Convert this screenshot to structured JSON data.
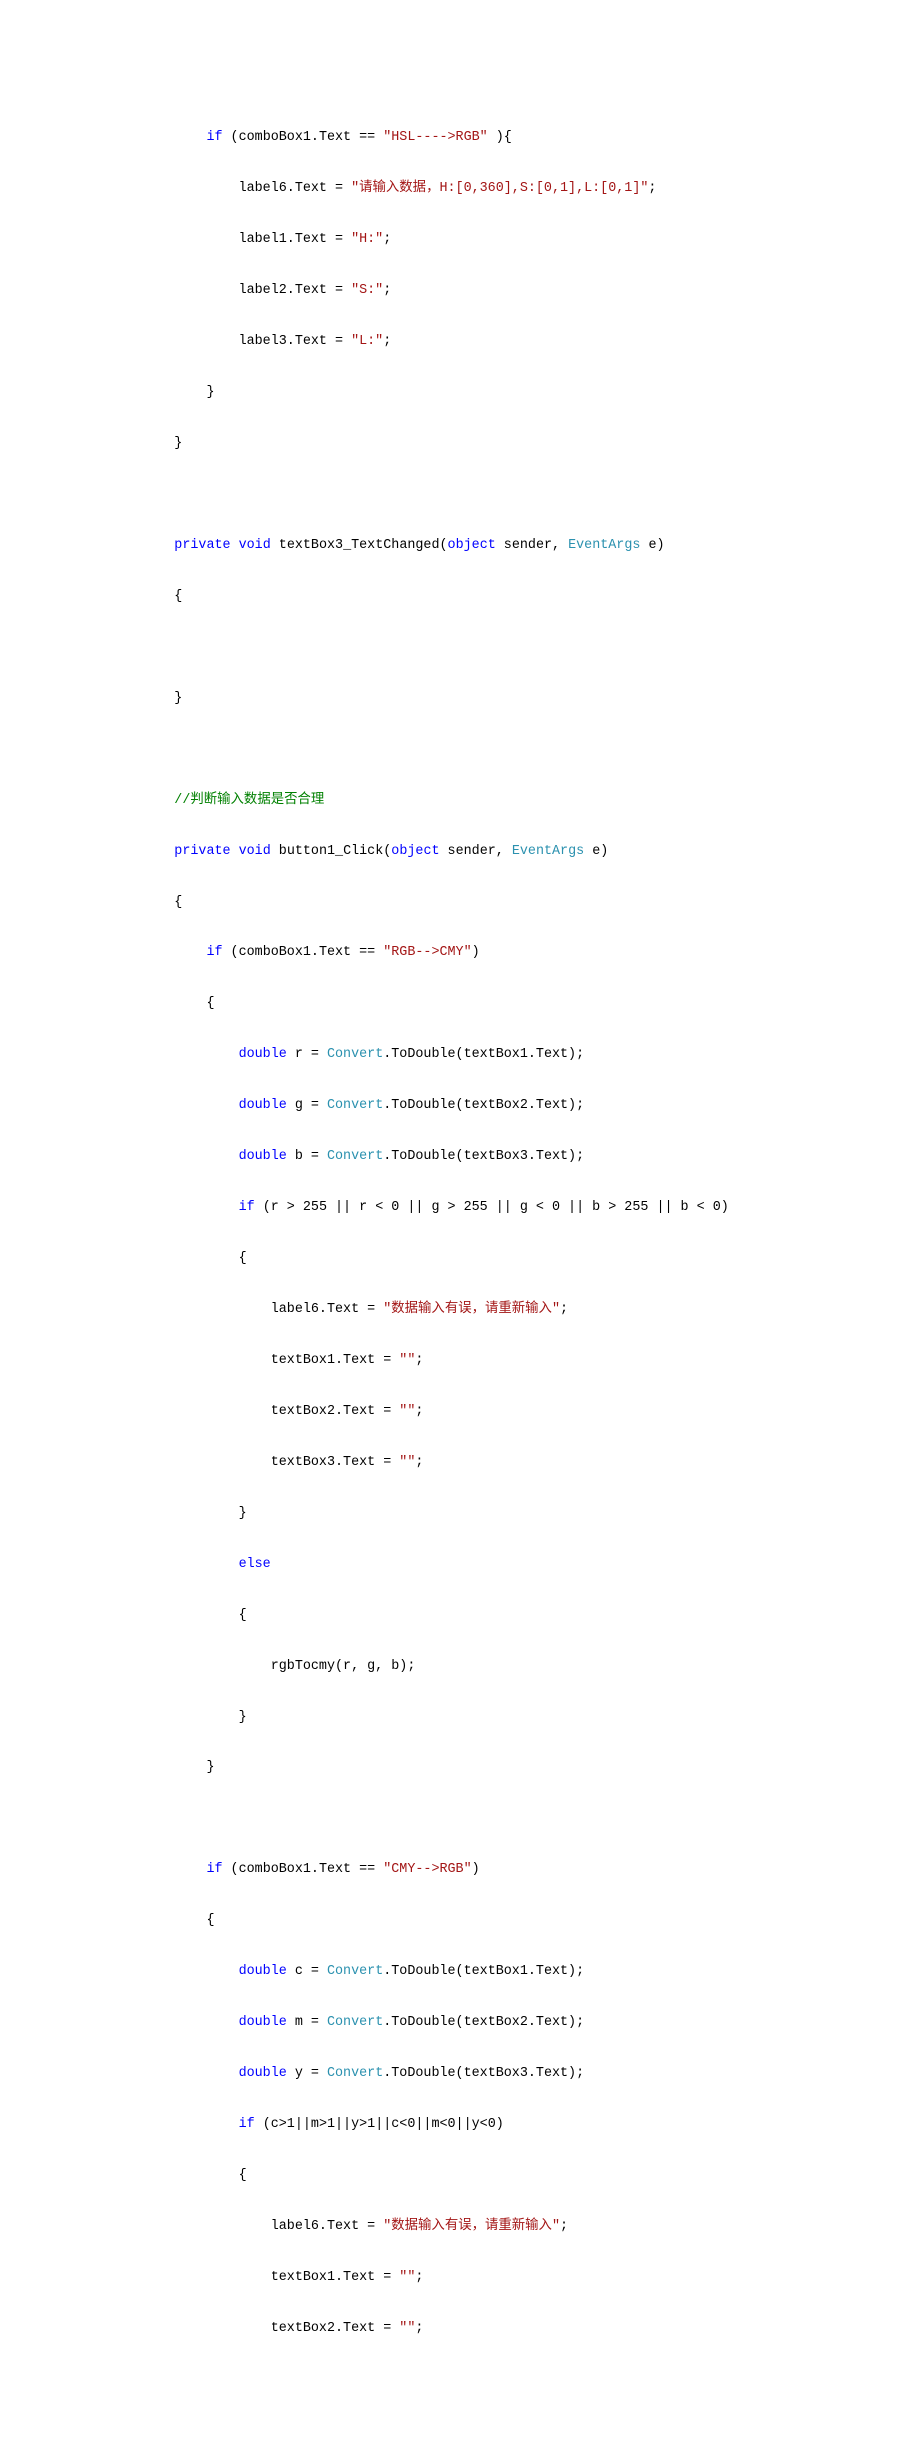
{
  "code": {
    "l1": {
      "pad": "            ",
      "kw": "if",
      "rest1": " (comboBox1.Text == ",
      "str": "\"HSL---->RGB\" ",
      "rest2": "){"
    },
    "l2": {
      "pad": "                ",
      "rest1": "label6.Text = ",
      "str": "\"请输入数据，H:[0,360],S:[0,1],L:[0,1]\"",
      "rest2": ";"
    },
    "l3": {
      "pad": "                ",
      "rest1": "label1.Text = ",
      "str": "\"H:\"",
      "rest2": ";"
    },
    "l4": {
      "pad": "                ",
      "rest1": "label2.Text = ",
      "str": "\"S:\"",
      "rest2": ";"
    },
    "l5": {
      "pad": "                ",
      "rest1": "label3.Text = ",
      "str": "\"L:\"",
      "rest2": ";"
    },
    "l6": {
      "pad": "            ",
      "rest1": "}"
    },
    "l7": {
      "pad": "        ",
      "rest1": "}"
    },
    "l8": "",
    "l9": {
      "pad": "        ",
      "kw1": "private",
      "sp1": " ",
      "kw2": "void",
      "rest1": " textBox3_TextChanged(",
      "kw3": "object",
      "rest2": " sender, ",
      "type": "EventArgs",
      "rest3": " e)"
    },
    "l10": {
      "pad": "        ",
      "rest1": "{"
    },
    "l11": "",
    "l12": {
      "pad": "        ",
      "rest1": "}"
    },
    "l13": "",
    "l14": {
      "pad": "        ",
      "cmt": "//判断输入数据是否合理"
    },
    "l15": {
      "pad": "        ",
      "kw1": "private",
      "sp1": " ",
      "kw2": "void",
      "rest1": " button1_Click(",
      "kw3": "object",
      "rest2": " sender, ",
      "type": "EventArgs",
      "rest3": " e)"
    },
    "l16": {
      "pad": "        ",
      "rest1": "{"
    },
    "l17": {
      "pad": "            ",
      "kw": "if",
      "rest1": " (comboBox1.Text == ",
      "str": "\"RGB-->CMY\"",
      "rest2": ")"
    },
    "l18": {
      "pad": "            ",
      "rest1": "{"
    },
    "l19": {
      "pad": "                ",
      "kw": "double",
      "rest1": " r = ",
      "type": "Convert",
      "rest2": ".ToDouble(textBox1.Text);"
    },
    "l20": {
      "pad": "                ",
      "kw": "double",
      "rest1": " g = ",
      "type": "Convert",
      "rest2": ".ToDouble(textBox2.Text);"
    },
    "l21": {
      "pad": "                ",
      "kw": "double",
      "rest1": " b = ",
      "type": "Convert",
      "rest2": ".ToDouble(textBox3.Text);"
    },
    "l22": {
      "pad": "                ",
      "kw": "if",
      "rest1": " (r > 255 || r < 0 || g > 255 || g < 0 || b > 255 || b < 0)"
    },
    "l23": {
      "pad": "                ",
      "rest1": "{"
    },
    "l24": {
      "pad": "                    ",
      "rest1": "label6.Text = ",
      "str": "\"数据输入有误，请重新输入\"",
      "rest2": ";"
    },
    "l25": {
      "pad": "                    ",
      "rest1": "textBox1.Text = ",
      "str": "\"\"",
      "rest2": ";"
    },
    "l26": {
      "pad": "                    ",
      "rest1": "textBox2.Text = ",
      "str": "\"\"",
      "rest2": ";"
    },
    "l27": {
      "pad": "                    ",
      "rest1": "textBox3.Text = ",
      "str": "\"\"",
      "rest2": ";"
    },
    "l28": {
      "pad": "                ",
      "rest1": "}"
    },
    "l29": {
      "pad": "                ",
      "kw": "else"
    },
    "l30": {
      "pad": "                ",
      "rest1": "{"
    },
    "l31": {
      "pad": "                    ",
      "rest1": "rgbTocmy(r, g, b);"
    },
    "l32": {
      "pad": "                ",
      "rest1": "}"
    },
    "l33": {
      "pad": "            ",
      "rest1": "}"
    },
    "l34": "",
    "l35": {
      "pad": "            ",
      "kw": "if",
      "rest1": " (comboBox1.Text == ",
      "str": "\"CMY-->RGB\"",
      "rest2": ")"
    },
    "l36": {
      "pad": "            ",
      "rest1": "{"
    },
    "l37": {
      "pad": "                ",
      "kw": "double",
      "rest1": " c = ",
      "type": "Convert",
      "rest2": ".ToDouble(textBox1.Text);"
    },
    "l38": {
      "pad": "                ",
      "kw": "double",
      "rest1": " m = ",
      "type": "Convert",
      "rest2": ".ToDouble(textBox2.Text);"
    },
    "l39": {
      "pad": "                ",
      "kw": "double",
      "rest1": " y = ",
      "type": "Convert",
      "rest2": ".ToDouble(textBox3.Text);"
    },
    "l40": {
      "pad": "                ",
      "kw": "if",
      "rest1": " (c>1||m>1||y>1||c<0||m<0||y<0)"
    },
    "l41": {
      "pad": "                ",
      "rest1": "{"
    },
    "l42": {
      "pad": "                    ",
      "rest1": "label6.Text = ",
      "str": "\"数据输入有误，请重新输入\"",
      "rest2": ";"
    },
    "l43": {
      "pad": "                    ",
      "rest1": "textBox1.Text = ",
      "str": "\"\"",
      "rest2": ";"
    },
    "l44": {
      "pad": "                    ",
      "rest1": "textBox2.Text = ",
      "str": "\"\"",
      "rest2": ";"
    }
  }
}
